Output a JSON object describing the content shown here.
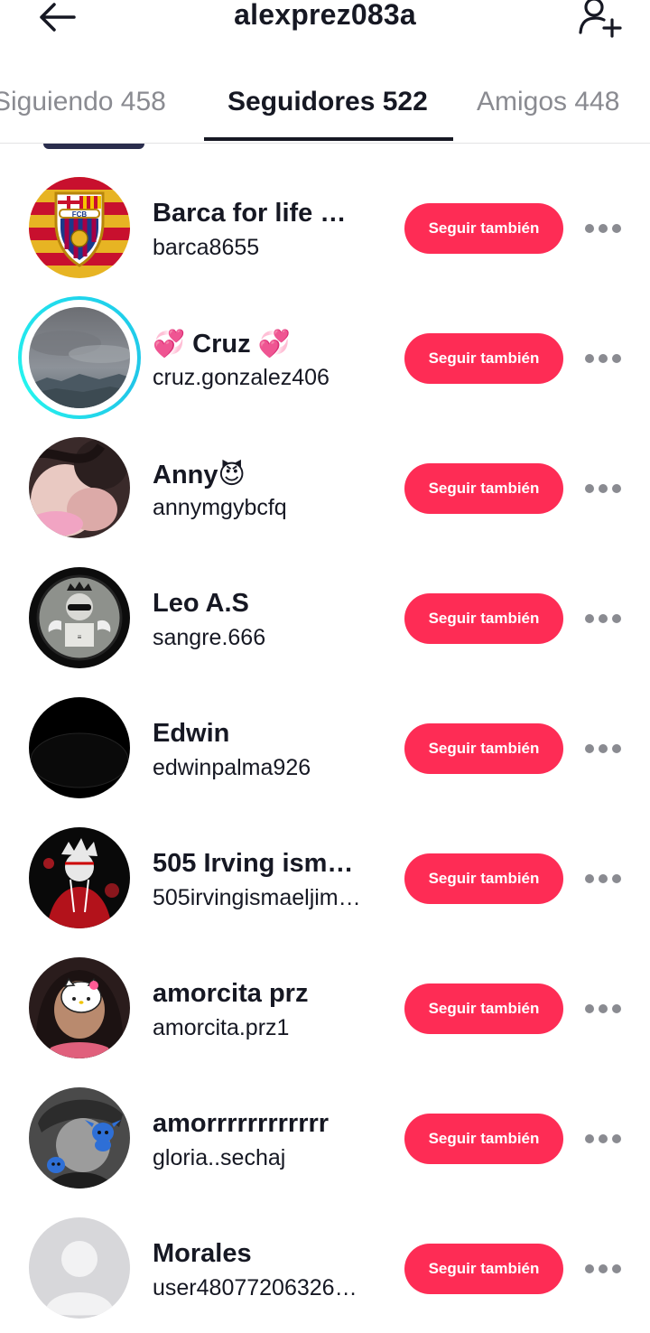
{
  "header": {
    "title": "alexprez083a",
    "back_icon": "arrow-left-icon",
    "add_icon": "person-add-icon"
  },
  "tabs": [
    {
      "label": "Siguiendo 458",
      "active": false
    },
    {
      "label": "Seguidores 522",
      "active": true
    },
    {
      "label": "Amigos 448",
      "active": false
    }
  ],
  "colors": {
    "accent": "#fe2c55",
    "text": "#161823",
    "muted": "#8a8b91",
    "story_ring": "#20d5ec"
  },
  "followers": [
    {
      "name": "Barca for life …",
      "handle": "barca8655",
      "button": "Seguir también",
      "avatar": "fc-barcelona-crest"
    },
    {
      "name": "💞  Cruz 💞",
      "handle": "cruz.gonzalez406",
      "button": "Seguir también",
      "avatar": "cloudy-landscape-photo",
      "story": true
    },
    {
      "name": "Anny😈",
      "handle": "annymgybcfq",
      "button": "Seguir también",
      "avatar": "portrait-photo"
    },
    {
      "name": "Leo A.S",
      "handle": "sangre.666",
      "button": "Seguir también",
      "avatar": "crowned-figure-drawing"
    },
    {
      "name": "Edwin",
      "handle": "edwinpalma926",
      "button": "Seguir también",
      "avatar": "black-avatar"
    },
    {
      "name": "505  Irving ism…",
      "handle": "505irvingismaeljim…",
      "button": "Seguir también",
      "avatar": "red-anime-character"
    },
    {
      "name": "amorcita prz",
      "handle": "amorcita.prz1",
      "button": "Seguir también",
      "avatar": "hello-kitty-filter-photo"
    },
    {
      "name": "amorrrrrrrrrrrr",
      "handle": "gloria..sechaj",
      "button": "Seguir también",
      "avatar": "stitch-sticker-photo"
    },
    {
      "name": "Morales",
      "handle": "user48077206326…",
      "button": "Seguir también",
      "avatar": "default-avatar"
    }
  ]
}
